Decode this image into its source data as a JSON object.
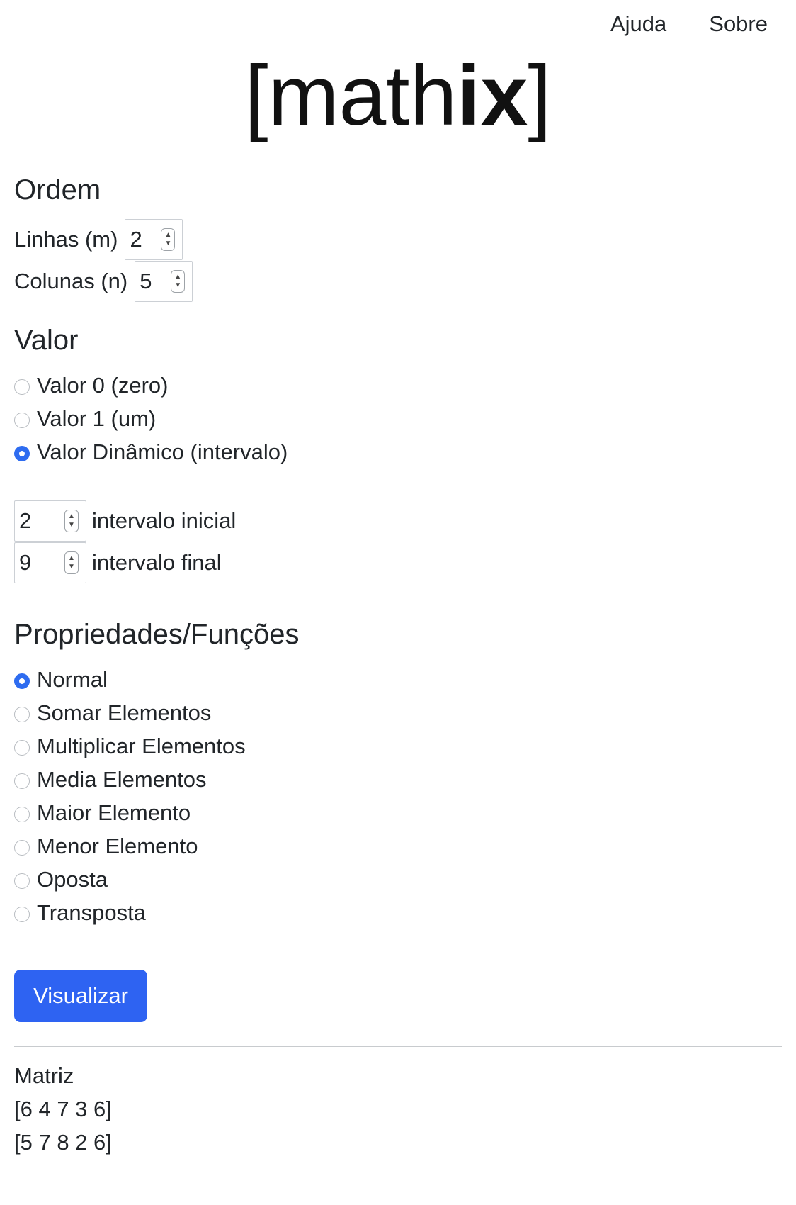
{
  "nav": {
    "help": "Ajuda",
    "about": "Sobre"
  },
  "logo": {
    "open_bracket": "[",
    "light": "math",
    "bold": "ix",
    "close_bracket": "]"
  },
  "order": {
    "heading": "Ordem",
    "rows_label": "Linhas (m)",
    "rows_value": "2",
    "cols_label": "Colunas (n)",
    "cols_value": "5"
  },
  "value": {
    "heading": "Valor",
    "options": [
      {
        "label": "Valor 0 (zero)",
        "checked": false
      },
      {
        "label": "Valor 1 (um)",
        "checked": false
      },
      {
        "label": "Valor Dinâmico (intervalo)",
        "checked": true
      }
    ],
    "range_start_value": "2",
    "range_start_label": "intervalo inicial",
    "range_end_value": "9",
    "range_end_label": "intervalo final"
  },
  "props": {
    "heading": "Propriedades/Funções",
    "options": [
      {
        "label": "Normal",
        "checked": true
      },
      {
        "label": "Somar Elementos",
        "checked": false
      },
      {
        "label": "Multiplicar Elementos",
        "checked": false
      },
      {
        "label": "Media Elementos",
        "checked": false
      },
      {
        "label": "Maior Elemento",
        "checked": false
      },
      {
        "label": "Menor Elemento",
        "checked": false
      },
      {
        "label": "Oposta",
        "checked": false
      },
      {
        "label": "Transposta",
        "checked": false
      }
    ]
  },
  "submit_label": "Visualizar",
  "result": {
    "title": "Matriz",
    "rows": [
      "[6 4 7 3 6]",
      "[5 7 8 2 6]"
    ]
  },
  "colors": {
    "accent": "#2e63f2",
    "text": "#212529"
  }
}
